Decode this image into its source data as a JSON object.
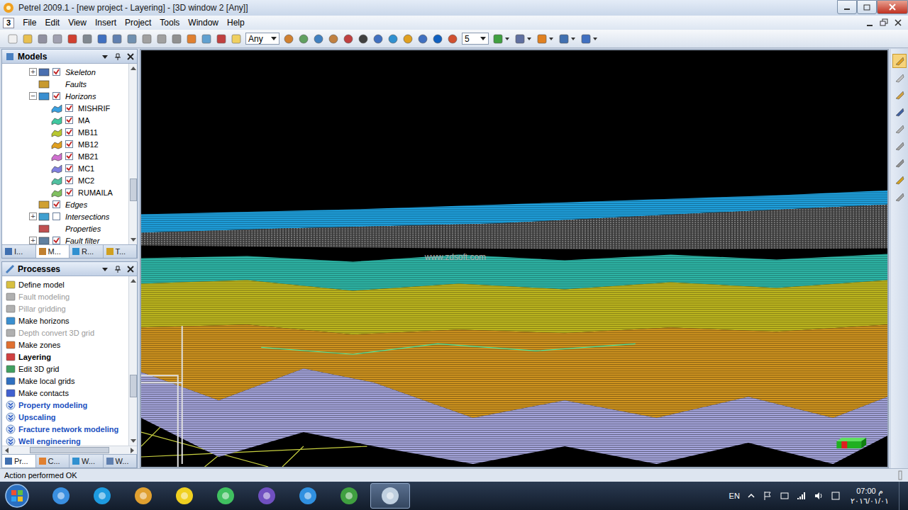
{
  "window": {
    "title": "Petrel 2009.1 - [new project - Layering] - [3D window 2 [Any]]"
  },
  "menu": {
    "app_icon": "3",
    "items": [
      "File",
      "Edit",
      "View",
      "Insert",
      "Project",
      "Tools",
      "Window",
      "Help"
    ]
  },
  "toolbar": {
    "filter": "Any",
    "number": "5"
  },
  "models_panel": {
    "title": "Models",
    "items": [
      {
        "label": "Skeleton",
        "level": 0,
        "expander": "+",
        "checkbox": true,
        "checked": true,
        "kind": "folder",
        "color": "#4a6fb0"
      },
      {
        "label": "Faults",
        "level": 0,
        "expander": "",
        "checkbox": false,
        "checked": false,
        "kind": "folder",
        "color": "#c89a30"
      },
      {
        "label": "Horizons",
        "level": 0,
        "expander": "−",
        "checkbox": true,
        "checked": true,
        "kind": "folder",
        "color": "#3a8fd0"
      },
      {
        "label": "MISHRIF",
        "level": 1,
        "expander": "",
        "checkbox": true,
        "checked": true,
        "kind": "horizon",
        "color": "#3aa0e0"
      },
      {
        "label": "MA",
        "level": 1,
        "expander": "",
        "checkbox": true,
        "checked": true,
        "kind": "horizon",
        "color": "#40c8a0"
      },
      {
        "label": "MB11",
        "level": 1,
        "expander": "",
        "checkbox": true,
        "checked": true,
        "kind": "horizon",
        "color": "#b8c830"
      },
      {
        "label": "MB12",
        "level": 1,
        "expander": "",
        "checkbox": true,
        "checked": true,
        "kind": "horizon",
        "color": "#e0a020"
      },
      {
        "label": "MB21",
        "level": 1,
        "expander": "",
        "checkbox": true,
        "checked": true,
        "kind": "horizon",
        "color": "#d070d0"
      },
      {
        "label": "MC1",
        "level": 1,
        "expander": "",
        "checkbox": true,
        "checked": true,
        "kind": "horizon",
        "color": "#8080e0"
      },
      {
        "label": "MC2",
        "level": 1,
        "expander": "",
        "checkbox": true,
        "checked": true,
        "kind": "horizon",
        "color": "#50c0a0"
      },
      {
        "label": "RUMAILA",
        "level": 1,
        "expander": "",
        "checkbox": true,
        "checked": true,
        "kind": "horizon",
        "color": "#80c060"
      },
      {
        "label": "Edges",
        "level": 0,
        "expander": "",
        "checkbox": true,
        "checked": true,
        "kind": "folder",
        "color": "#d0a030"
      },
      {
        "label": "Intersections",
        "level": 0,
        "expander": "+",
        "checkbox": true,
        "checked": false,
        "kind": "folder",
        "color": "#40a0d0"
      },
      {
        "label": "Properties",
        "level": 0,
        "expander": "",
        "checkbox": false,
        "checked": false,
        "kind": "folder",
        "color": "#c05050"
      },
      {
        "label": "Fault filter",
        "level": 0,
        "expander": "+",
        "checkbox": true,
        "checked": true,
        "kind": "folder",
        "color": "#6080a0"
      }
    ],
    "tabs": [
      {
        "label": "I...",
        "selected": false
      },
      {
        "label": "M...",
        "selected": true
      },
      {
        "label": "R...",
        "selected": false
      },
      {
        "label": "T...",
        "selected": false
      }
    ]
  },
  "processes_panel": {
    "title": "Processes",
    "items": [
      {
        "label": "Define model",
        "kind": "process",
        "disabled": false,
        "selected": false,
        "color": "#d8c040"
      },
      {
        "label": "Fault modeling",
        "kind": "process",
        "disabled": true,
        "selected": false,
        "color": "#b0b0b0"
      },
      {
        "label": "Pillar gridding",
        "kind": "process",
        "disabled": true,
        "selected": false,
        "color": "#b0b0b0"
      },
      {
        "label": "Make horizons",
        "kind": "process",
        "disabled": false,
        "selected": false,
        "color": "#3a8fd0"
      },
      {
        "label": "Depth convert 3D grid",
        "kind": "process",
        "disabled": true,
        "selected": false,
        "color": "#b0b0b0"
      },
      {
        "label": "Make zones",
        "kind": "process",
        "disabled": false,
        "selected": false,
        "color": "#e07030"
      },
      {
        "label": "Layering",
        "kind": "process",
        "disabled": false,
        "selected": true,
        "color": "#d04040"
      },
      {
        "label": "Edit 3D grid",
        "kind": "process",
        "disabled": false,
        "selected": false,
        "color": "#40a060"
      },
      {
        "label": "Make local grids",
        "kind": "process",
        "disabled": false,
        "selected": false,
        "color": "#3070c0"
      },
      {
        "label": "Make contacts",
        "kind": "process",
        "disabled": false,
        "selected": false,
        "color": "#4060d0"
      },
      {
        "label": "Property modeling",
        "kind": "category",
        "disabled": false,
        "selected": false,
        "color": "#2050c0"
      },
      {
        "label": "Upscaling",
        "kind": "category",
        "disabled": false,
        "selected": false,
        "color": "#2050c0"
      },
      {
        "label": "Fracture network modeling",
        "kind": "category",
        "disabled": false,
        "selected": false,
        "color": "#2050c0"
      },
      {
        "label": "Well engineering",
        "kind": "category",
        "disabled": false,
        "selected": false,
        "color": "#2050c0"
      }
    ],
    "tabs": [
      {
        "label": "Pr...",
        "selected": true
      },
      {
        "label": "C...",
        "selected": false
      },
      {
        "label": "W...",
        "selected": false
      },
      {
        "label": "W...",
        "selected": false
      }
    ]
  },
  "viewport": {
    "watermark": "www.zdsoft.com"
  },
  "status_bar": {
    "text": "Action performed OK"
  },
  "taskbar": {
    "apps": [
      {
        "selected": false
      },
      {
        "selected": false
      },
      {
        "selected": false
      },
      {
        "selected": false
      },
      {
        "selected": false
      },
      {
        "selected": false
      },
      {
        "selected": false
      },
      {
        "selected": false
      },
      {
        "selected": true
      }
    ],
    "language": "EN",
    "time": "07:00 م",
    "date": "٢٠١٦/٠١/٠١"
  }
}
